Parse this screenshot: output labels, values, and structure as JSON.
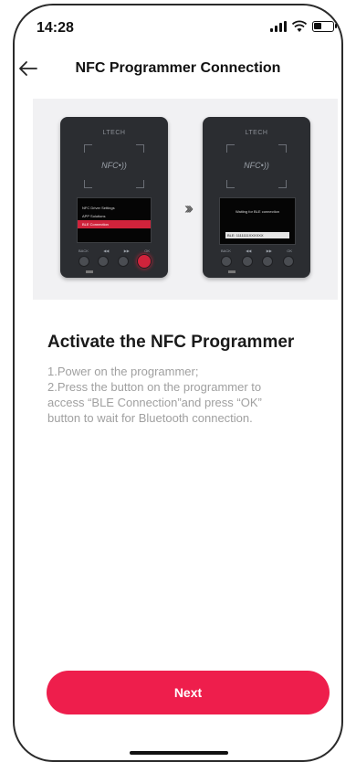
{
  "status_bar": {
    "time": "14:28"
  },
  "nav": {
    "title": "NFC Programmer Connection",
    "back_icon": "arrow-left-icon"
  },
  "illustration": {
    "brand": "LTECH",
    "nfc_label": "NFC•))",
    "left_screen_menu": [
      "NFC Driver Settings",
      "APP Solutions",
      "BLE Connection"
    ],
    "left_screen_active_index": 2,
    "right_screen_text": "Waiting for BLE connection",
    "right_screen_code": "BLE: 1111111XXXXXX",
    "button_labels": [
      "BACK",
      "◀◀",
      "▶▶",
      "OK"
    ],
    "arrows": "›››"
  },
  "content": {
    "title": "Activate the NFC Programmer",
    "instructions": [
      "1.Power on the programmer;",
      "2.Press the button on the programmer to",
      "access “BLE Connection”and press “OK”",
      "button to wait for Bluetooth connection."
    ]
  },
  "actions": {
    "next_label": "Next"
  },
  "colors": {
    "accent": "#ee1e4c",
    "device_body": "#2b2d31",
    "active_menu": "#d0233b"
  }
}
